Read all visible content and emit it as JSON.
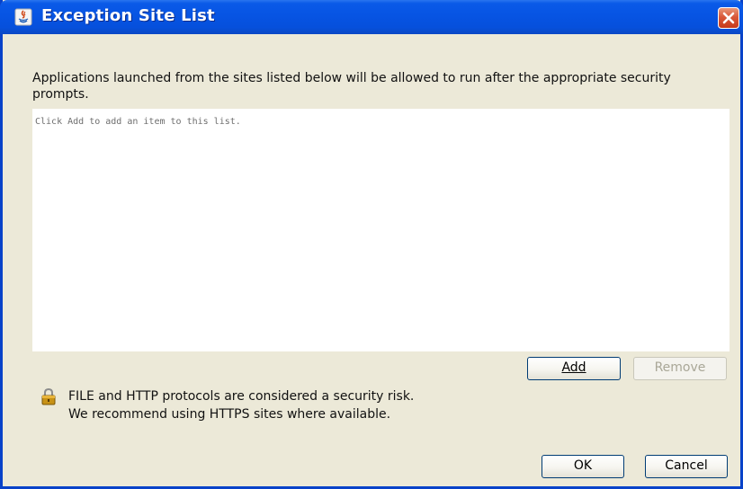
{
  "window": {
    "title": "Exception Site List"
  },
  "content": {
    "instruction": "Applications launched from the sites listed below will be allowed to run after the appropriate security prompts.",
    "list_placeholder": "Click Add to add an item to this list."
  },
  "buttons": {
    "add": "Add",
    "remove": "Remove",
    "ok": "OK",
    "cancel": "Cancel"
  },
  "warning": {
    "line1": "FILE and HTTP protocols are considered a security risk.",
    "line2": "We recommend using HTTPS sites where available."
  },
  "icons": {
    "title": "java-icon",
    "warning": "lock-icon",
    "close": "close-icon"
  },
  "colors": {
    "titlebar": "#0754e3",
    "close_button": "#d9583a",
    "dialog_bg": "#ece9d8"
  }
}
